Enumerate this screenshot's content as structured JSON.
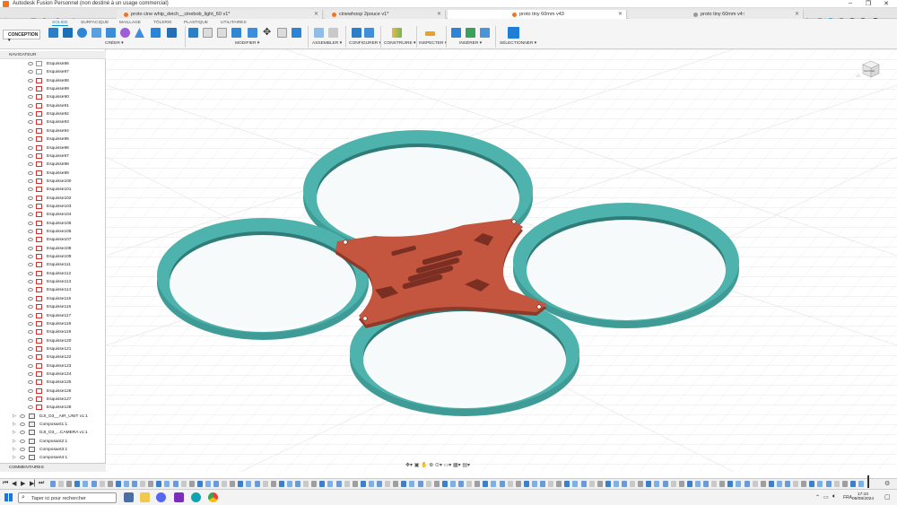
{
  "window": {
    "title": "Autodesk Fusion Personnel (non destiné à un usage commercial)"
  },
  "tabs": [
    {
      "label": "proto cine whip_deich__cinebob_light_60 v1*",
      "active": false
    },
    {
      "label": "cinewhoop 2pouce v1*",
      "active": false
    },
    {
      "label": "proto tiny 60mm v43",
      "active": true
    },
    {
      "label": "proto tiny 60mm v4↑",
      "active": false
    }
  ],
  "ribbon": {
    "tabs": [
      "SOLIDE",
      "SURFACIQUE",
      "MAILLAGE",
      "TÔLERIE",
      "PLASTIQUE",
      "UTILITAIRES"
    ],
    "active_tab": "SOLIDE",
    "workspace": "CONCEPTION ▾",
    "groups": [
      "CRÉER ▾",
      "MODIFIER ▾",
      "ASSEMBLER ▾",
      "CONFIGURER ▾",
      "CONSTRUIRE ▾",
      "INSPECTER ▾",
      "INSÉRER ▾",
      "SÉLECTIONNER ▾"
    ]
  },
  "browser": {
    "header": "NAVIGATEUR",
    "sketches": [
      "Esquisse86",
      "Esquisse87",
      "Esquisse88",
      "Esquisse89",
      "Esquisse90",
      "Esquisse91",
      "Esquisse92",
      "Esquisse93",
      "Esquisse94",
      "Esquisse95",
      "Esquisse96",
      "Esquisse97",
      "Esquisse98",
      "Esquisse99",
      "Esquisse100",
      "Esquisse101",
      "Esquisse102",
      "Esquisse103",
      "Esquisse104",
      "Esquisse105",
      "Esquisse106",
      "Esquisse107",
      "Esquisse108",
      "Esquisse109",
      "Esquisse111",
      "Esquisse112",
      "Esquisse113",
      "Esquisse114",
      "Esquisse115",
      "Esquisse116",
      "Esquisse117",
      "Esquisse118",
      "Esquisse119",
      "Esquisse120",
      "Esquisse121",
      "Esquisse122",
      "Esquisse123",
      "Esquisse124",
      "Esquisse125",
      "Esquisse126",
      "Esquisse127",
      "Esquisse128"
    ],
    "components": [
      "DJI_O3__AIR_UNIT v1:1",
      "Composant1:1",
      "DJI_O3_...CAMERA v1:1",
      "Composant2:1",
      "Composant3:1",
      "Composant4:1"
    ],
    "comments": "COMMENTAIRES"
  },
  "viewcube": {
    "label": "GAUCHE"
  },
  "taskbar": {
    "search_placeholder": "Taper ici pour rechercher",
    "lang": "FRA",
    "time": "17:10",
    "date": "09/08/2024"
  },
  "colors": {
    "frame": "#c4553f",
    "guard": "#4fb3ad",
    "accent": "#0696d7"
  }
}
